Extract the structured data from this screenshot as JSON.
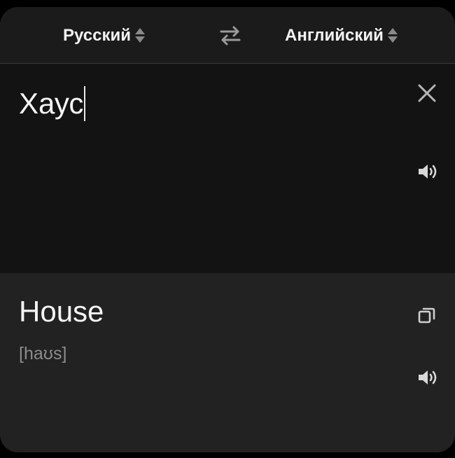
{
  "languages": {
    "source": "Русский",
    "target": "Английский"
  },
  "input": {
    "text": "Хаус"
  },
  "output": {
    "translation": "House",
    "transcription": "[haʊs]"
  },
  "icons": {
    "swap": "swap-arrows-icon",
    "clear": "close-icon",
    "speak": "speaker-icon",
    "copy": "copy-icon",
    "selector": "up-down-arrows-icon"
  },
  "colors": {
    "background": "#000000",
    "card": "#1b1b1b",
    "input_bg": "#131313",
    "output_bg": "#222222",
    "text": "#f2f2f2",
    "muted": "#8c8c8c"
  }
}
